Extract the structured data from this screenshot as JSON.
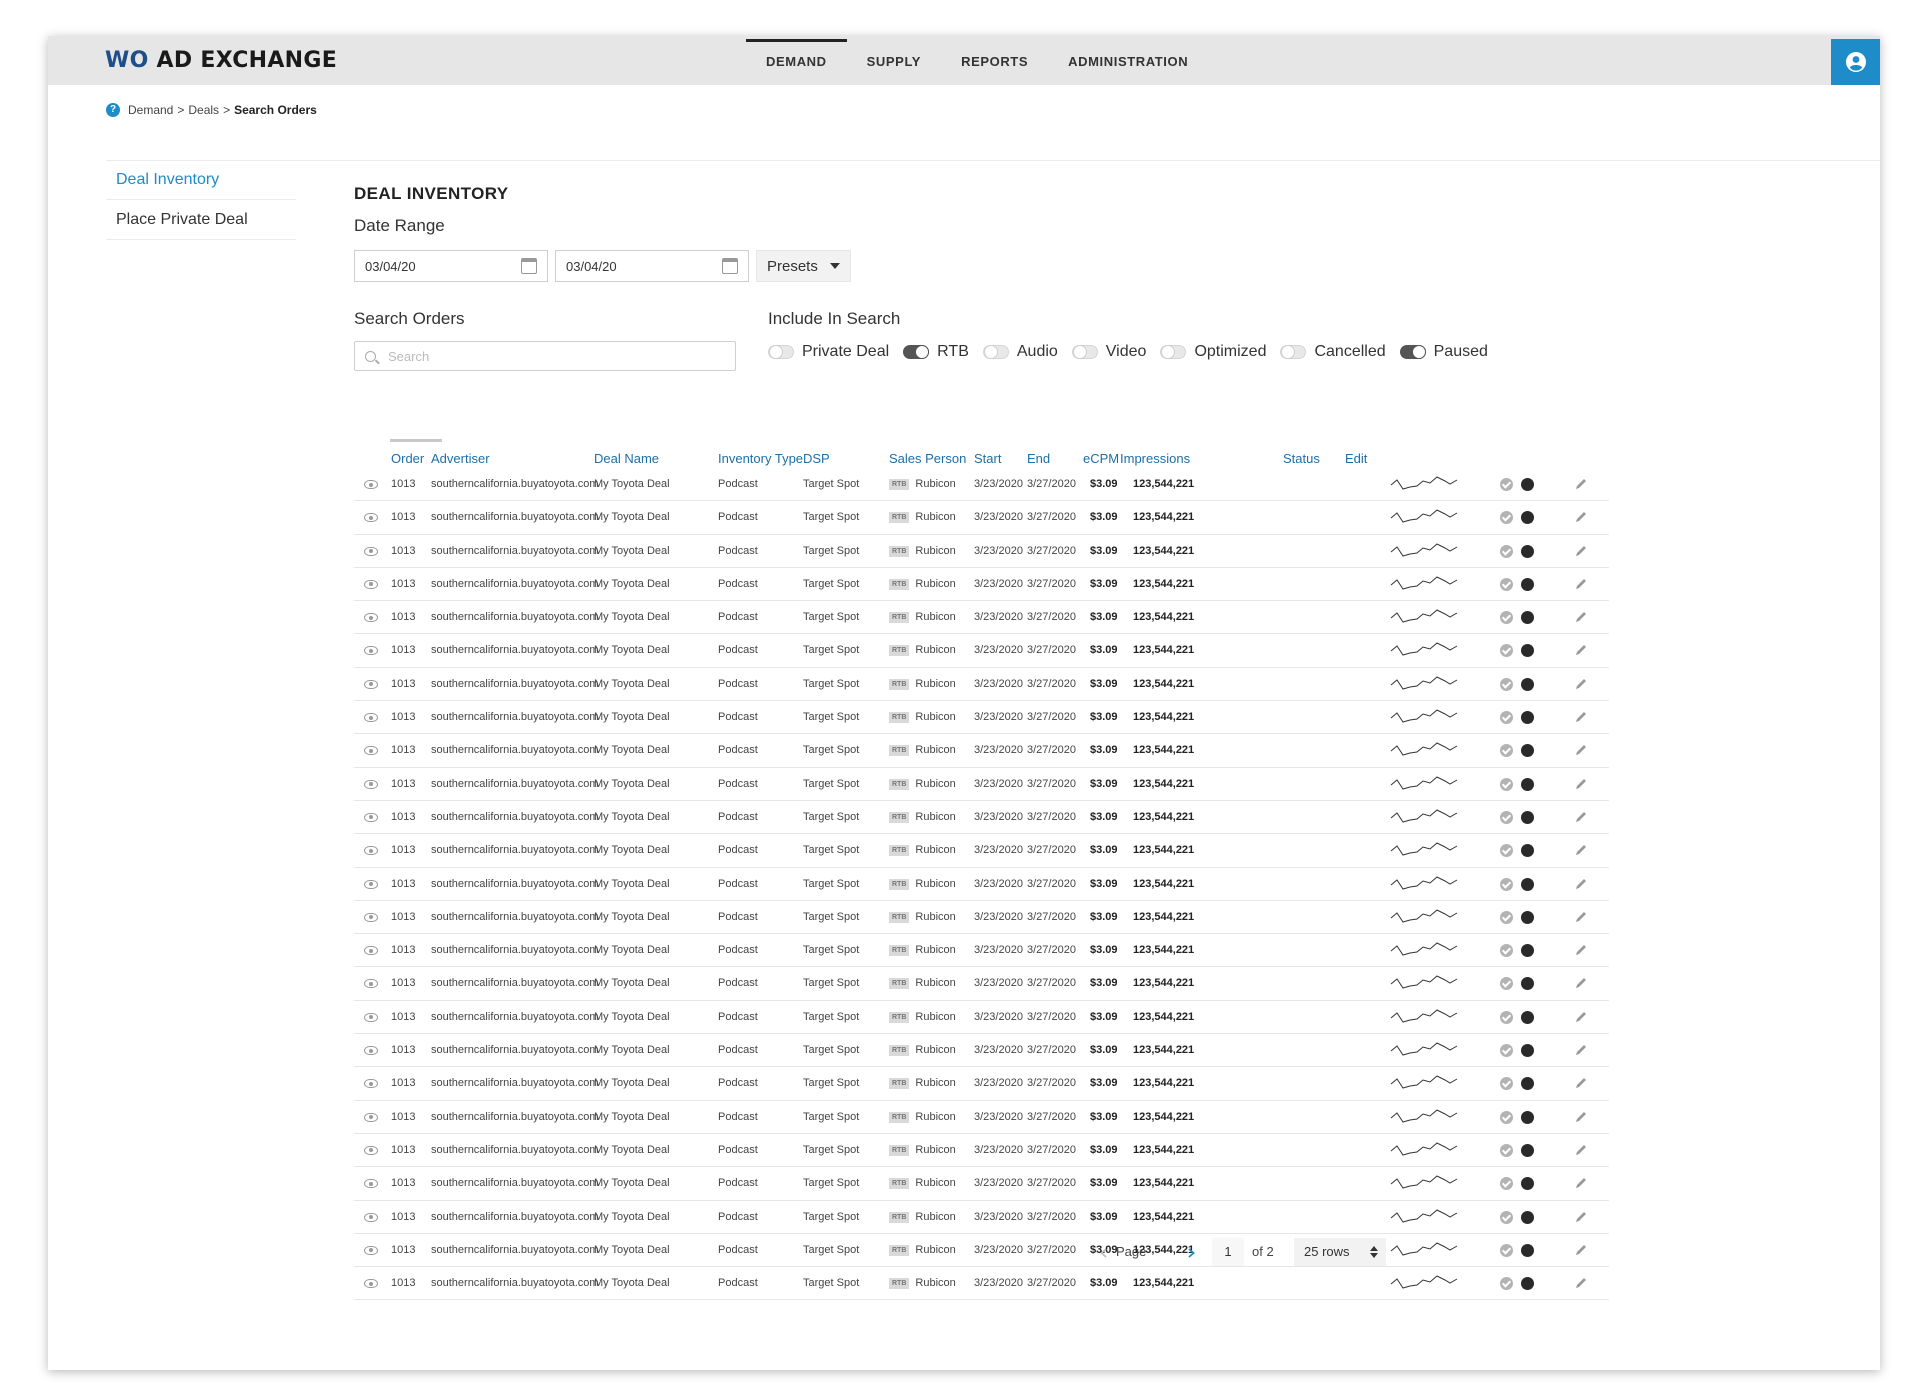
{
  "app": {
    "logo_prefix": "WO",
    "logo_rest": " AD EXCHANGE"
  },
  "nav": [
    {
      "label": "DEMAND",
      "active": true
    },
    {
      "label": "SUPPLY",
      "active": false
    },
    {
      "label": "REPORTS",
      "active": false
    },
    {
      "label": "ADMINISTRATION",
      "active": false
    }
  ],
  "breadcrumb": {
    "items": [
      "Demand",
      "Deals"
    ],
    "current": "Search Orders",
    "separator": ">"
  },
  "sidebar": [
    {
      "label": "Deal Inventory",
      "active": true
    },
    {
      "label": "Place Private Deal",
      "active": false
    }
  ],
  "main": {
    "title": "DEAL INVENTORY",
    "date_range_label": "Date Range",
    "start_date": "03/04/20",
    "end_date": "03/04/20",
    "presets_label": "Presets",
    "search_label": "Search Orders",
    "search_placeholder": "Search",
    "include_label": "Include In Search",
    "include_options": [
      {
        "label": "Private Deal",
        "on": false
      },
      {
        "label": "RTB",
        "on": true
      },
      {
        "label": "Audio",
        "on": false
      },
      {
        "label": "Video",
        "on": false
      },
      {
        "label": "Optimized",
        "on": false
      },
      {
        "label": "Cancelled",
        "on": false
      },
      {
        "label": "Paused",
        "on": true
      }
    ]
  },
  "table": {
    "columns": [
      "Order",
      "Advertiser",
      "Deal Name",
      "Inventory Type",
      "DSP",
      "Sales Person",
      "Start",
      "End",
      "eCPM",
      "Impressions",
      "Status",
      "Edit"
    ],
    "row_template": {
      "order": "1013",
      "advertiser": "southerncalifornia.buyatoyota.com",
      "deal_name": "My Toyota Deal",
      "inventory_type": "Podcast",
      "dsp": "Target Spot",
      "badge": "RTB",
      "sales_person": "Rubicon",
      "start": "3/23/2020",
      "end": "3/27/2020",
      "ecpm": "$3.09",
      "impressions": "123,544,221"
    },
    "row_count": 25
  },
  "pager": {
    "page_label": "Page",
    "page": "1",
    "of_label": "of 2",
    "rows_label": "25 rows"
  },
  "colors": {
    "accent": "#1d8cc8",
    "header_link": "#1d6fa5",
    "logo_blue": "#1f4f88"
  }
}
